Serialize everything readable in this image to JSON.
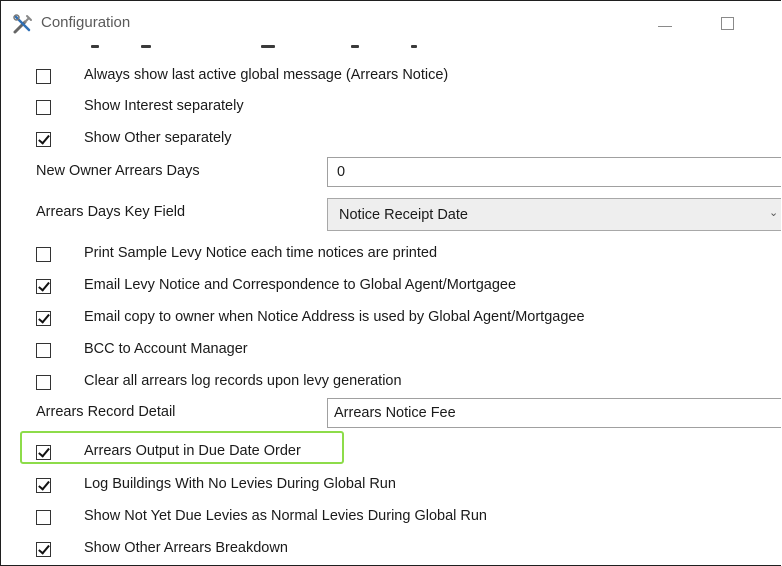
{
  "window": {
    "title": "Configuration",
    "app_icon": "tools-icon"
  },
  "settings": {
    "show_last_global_message": {
      "label": "Always show last active global message (Arrears Notice)",
      "checked": false
    },
    "show_interest_separately": {
      "label": "Show Interest separately",
      "checked": false
    },
    "show_other_separately": {
      "label": "Show Other separately",
      "checked": true
    },
    "new_owner_arrears_days": {
      "label": "New Owner Arrears Days",
      "value": "0"
    },
    "arrears_days_key_field": {
      "label": "Arrears Days Key Field",
      "value": "Notice Receipt Date"
    },
    "print_sample_levy_notice": {
      "label": "Print Sample Levy Notice each time notices are printed",
      "checked": false
    },
    "email_levy_notice": {
      "label": "Email Levy Notice and Correspondence to Global Agent/Mortgagee",
      "checked": true
    },
    "email_copy_to_owner": {
      "label": "Email copy to owner when Notice Address is used by Global Agent/Mortgagee",
      "checked": true
    },
    "bcc_account_manager": {
      "label": "BCC to Account Manager",
      "checked": false
    },
    "clear_arrears_log": {
      "label": "Clear all arrears log records upon levy generation",
      "checked": false
    },
    "arrears_record_detail": {
      "label": "Arrears Record Detail",
      "value": "Arrears Notice Fee"
    },
    "arrears_output_due_date": {
      "label": "Arrears Output in Due Date Order",
      "checked": true
    },
    "log_buildings_no_levies": {
      "label": "Log Buildings With No Levies During Global Run",
      "checked": true
    },
    "show_not_yet_due": {
      "label": "Show Not Yet Due Levies as Normal Levies During Global Run",
      "checked": false
    },
    "show_other_arrears_breakdown": {
      "label": "Show Other Arrears Breakdown",
      "checked": true
    }
  },
  "colors": {
    "highlight": "#8ddc4a",
    "select_bg": "#eeeeee"
  }
}
